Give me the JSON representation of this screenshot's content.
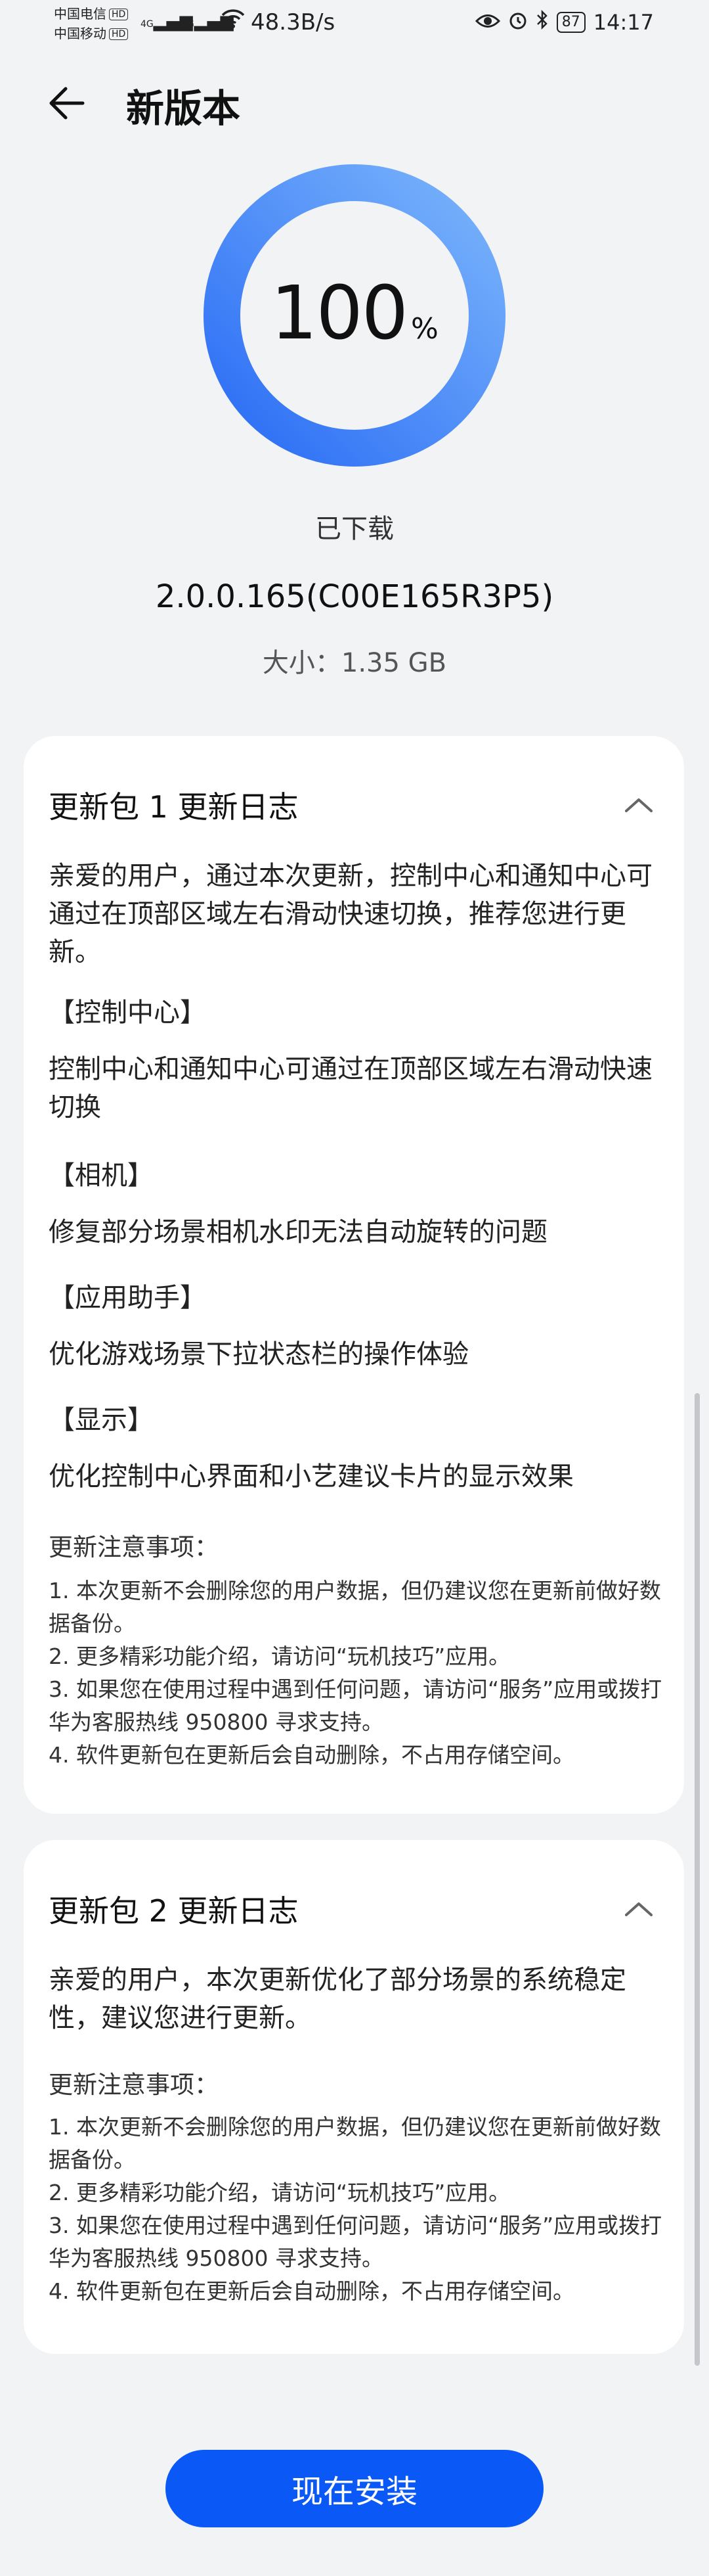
{
  "status_bar": {
    "carrier1": "中国电信",
    "carrier2": "中国移动",
    "hd": "HD",
    "net1": "4G",
    "net2": "4G",
    "net_speed": "48.3B/s",
    "battery": "87",
    "time": "14:17"
  },
  "header": {
    "title": "新版本"
  },
  "download": {
    "percent": "100",
    "percent_symbol": "%",
    "status": "已下载",
    "version": "2.0.0.165(C00E165R3P5)",
    "size": "大小：1.35 GB"
  },
  "card1": {
    "title": "更新包 1 更新日志",
    "intro": "亲爱的用户，通过本次更新，控制中心和通知中心可通过在顶部区域左右滑动快速切换，推荐您进行更新。",
    "sections": [
      {
        "heading": "【控制中心】",
        "body": "控制中心和通知中心可通过在顶部区域左右滑动快速切换"
      },
      {
        "heading": "【相机】",
        "body": "修复部分场景相机水印无法自动旋转的问题"
      },
      {
        "heading": "【应用助手】",
        "body": "优化游戏场景下拉状态栏的操作体验"
      },
      {
        "heading": "【显示】",
        "body": "优化控制中心界面和小艺建议卡片的显示效果"
      }
    ],
    "notes_title": "更新注意事项：",
    "notes": [
      "1. 本次更新不会删除您的用户数据，但仍建议您在更新前做好数据备份。",
      "2. 更多精彩功能介绍，请访问“玩机技巧”应用。",
      "3. 如果您在使用过程中遇到任何问题，请访问“服务”应用或拨打华为客服热线 950800 寻求支持。",
      "4. 软件更新包在更新后会自动删除，不占用存储空间。"
    ]
  },
  "card2": {
    "title": "更新包 2 更新日志",
    "intro": "亲爱的用户，本次更新优化了部分场景的系统稳定性，建议您进行更新。",
    "notes_title": "更新注意事项：",
    "notes": [
      "1. 本次更新不会删除您的用户数据，但仍建议您在更新前做好数据备份。",
      "2. 更多精彩功能介绍，请访问“玩机技巧”应用。",
      "3. 如果您在使用过程中遇到任何问题，请访问“服务”应用或拨打华为客服热线 950800 寻求支持。",
      "4. 软件更新包在更新后会自动删除，不占用存储空间。"
    ]
  },
  "install_button": "现在安装",
  "colors": {
    "accent": "#0a59f7",
    "ring_start": "#2a6cf5",
    "ring_end": "#7ab4fb"
  },
  "icons": [
    "back-arrow-icon",
    "chevron-up-icon",
    "wifi-icon",
    "eye-icon",
    "bluetooth-icon",
    "alarm-icon",
    "battery-icon"
  ]
}
